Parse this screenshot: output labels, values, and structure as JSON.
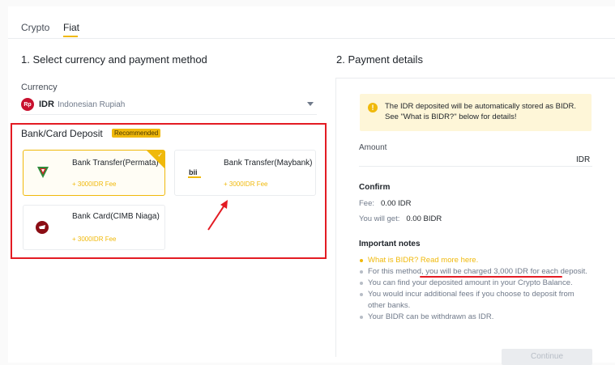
{
  "tabs": [
    {
      "label": "Crypto",
      "active": false
    },
    {
      "label": "Fiat",
      "active": true
    }
  ],
  "left": {
    "section_title": "1. Select currency and payment method",
    "currency_label": "Currency",
    "currency": {
      "badge": "Rp",
      "code": "IDR",
      "name": "Indonesian Rupiah"
    },
    "deposit_title": "Bank/Card Deposit",
    "recommended_badge": "Recommended",
    "methods": [
      {
        "name": "Bank Transfer(Permata)",
        "fee": "+ 3000IDR Fee",
        "selected": true,
        "icon": "permata-logo-icon"
      },
      {
        "name": "Bank Transfer(Maybank)",
        "fee": "+ 3000IDR Fee",
        "selected": false,
        "icon": "maybank-logo-icon",
        "logo_text": "bii"
      },
      {
        "name": "Bank Card(CIMB Niaga)",
        "fee": "+ 3000IDR Fee",
        "selected": false,
        "icon": "cimb-logo-icon"
      }
    ]
  },
  "right": {
    "section_title": "2. Payment details",
    "notice": "The IDR deposited will be automatically stored as BIDR. See \"What is BIDR?\" below for details!",
    "amount_label": "Amount",
    "amount_unit": "IDR",
    "confirm_title": "Confirm",
    "fee_label": "Fee:",
    "fee_value": "0.00 IDR",
    "get_label": "You will get:",
    "get_value": "0.00 BIDR",
    "notes_title": "Important notes",
    "notes": [
      "What is BIDR? Read more here.",
      "For this method, you will be charged 3,000 IDR for each deposit.",
      "You can find your deposited amount in your Crypto Balance.",
      "You would incur additional fees if you choose to deposit from other banks.",
      "Your BIDR can be withdrawn as IDR."
    ],
    "continue_label": "Continue"
  },
  "colors": {
    "accent": "#f0b90b",
    "highlight": "#e31b23",
    "text": "#1e2329",
    "muted": "#707a8a"
  }
}
